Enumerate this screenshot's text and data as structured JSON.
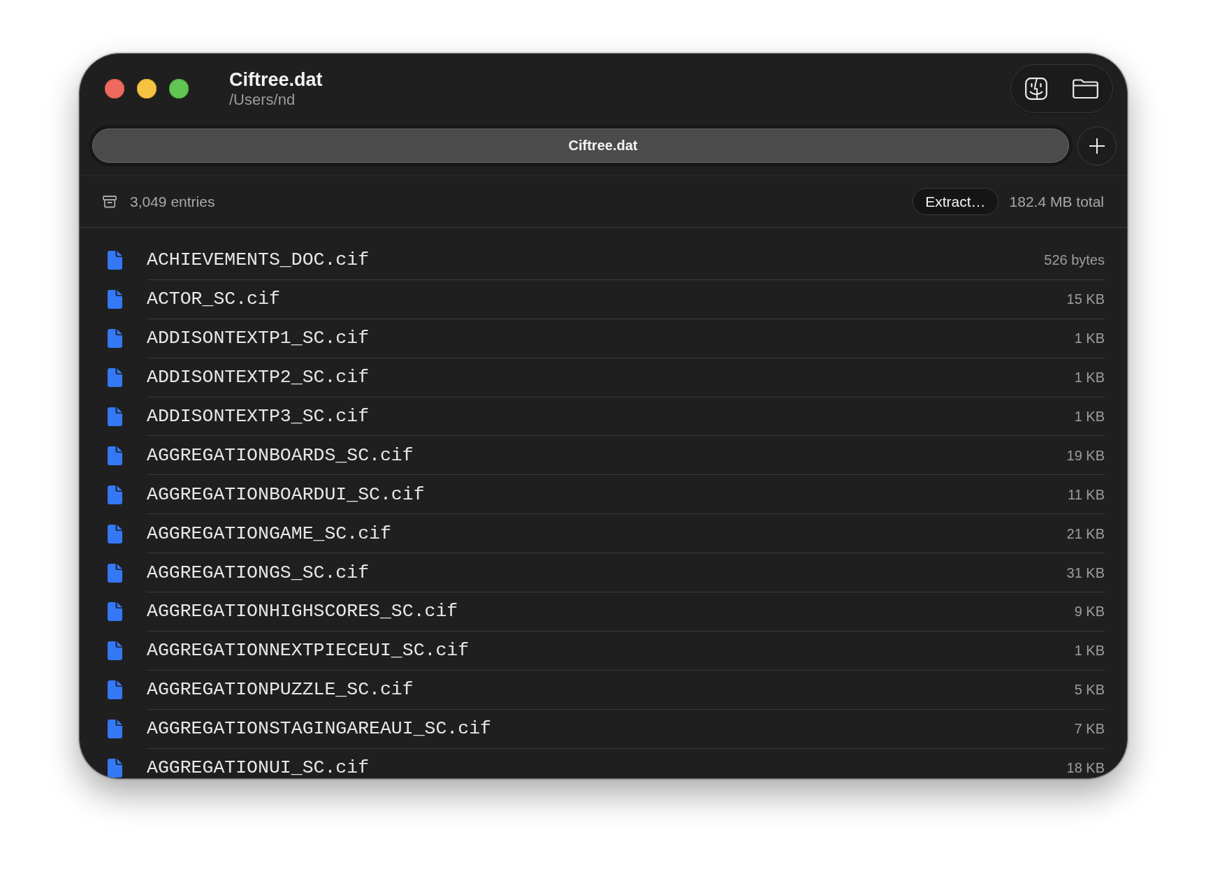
{
  "window": {
    "title": "Ciftree.dat",
    "subtitle": "/Users/nd"
  },
  "tabs": [
    {
      "label": "Ciftree.dat",
      "selected": true
    }
  ],
  "info_bar": {
    "entries": "3,049 entries",
    "extract_button": "Extract…",
    "total": "182.4 MB total"
  },
  "files": [
    {
      "name": "ACHIEVEMENTS_DOC.cif",
      "size": "526 bytes"
    },
    {
      "name": "ACTOR_SC.cif",
      "size": "15 KB"
    },
    {
      "name": "ADDISONTEXTP1_SC.cif",
      "size": "1 KB"
    },
    {
      "name": "ADDISONTEXTP2_SC.cif",
      "size": "1 KB"
    },
    {
      "name": "ADDISONTEXTP3_SC.cif",
      "size": "1 KB"
    },
    {
      "name": "AGGREGATIONBOARDS_SC.cif",
      "size": "19 KB"
    },
    {
      "name": "AGGREGATIONBOARDUI_SC.cif",
      "size": "11 KB"
    },
    {
      "name": "AGGREGATIONGAME_SC.cif",
      "size": "21 KB"
    },
    {
      "name": "AGGREGATIONGS_SC.cif",
      "size": "31 KB"
    },
    {
      "name": "AGGREGATIONHIGHSCORES_SC.cif",
      "size": "9 KB"
    },
    {
      "name": "AGGREGATIONNEXTPIECEUI_SC.cif",
      "size": "1 KB"
    },
    {
      "name": "AGGREGATIONPUZZLE_SC.cif",
      "size": "5 KB"
    },
    {
      "name": "AGGREGATIONSTAGINGAREAUI_SC.cif",
      "size": "7 KB"
    },
    {
      "name": "AGGREGATIONUI_SC.cif",
      "size": "18 KB"
    }
  ]
}
